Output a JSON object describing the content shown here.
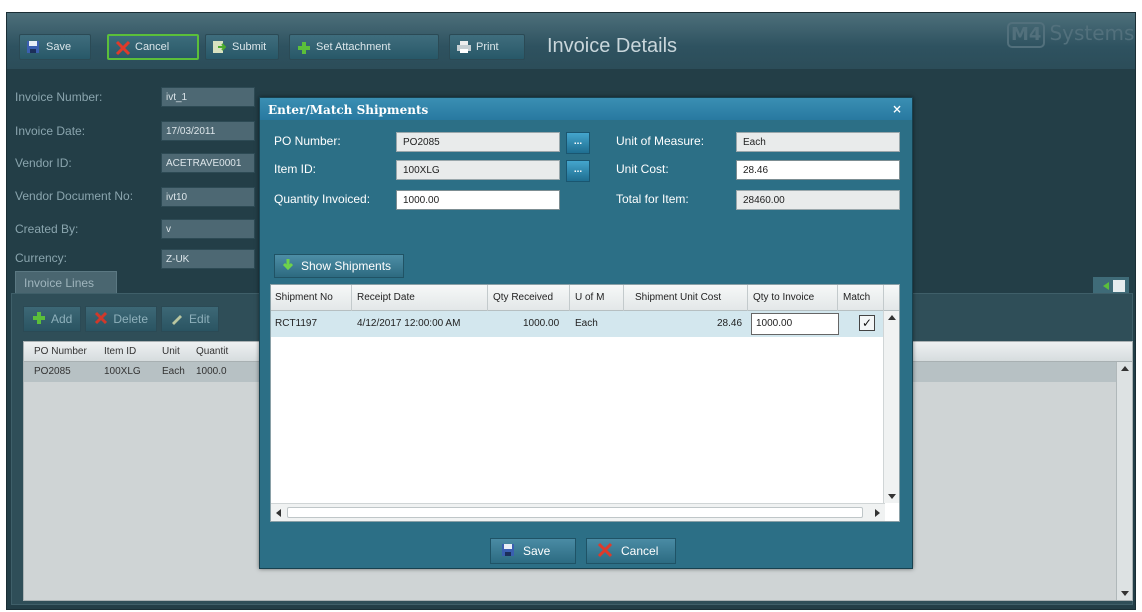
{
  "toolbar": {
    "save": "Save",
    "cancel": "Cancel",
    "submit": "Submit",
    "set_attachment": "Set Attachment",
    "print": "Print",
    "title": "Invoice Details",
    "brand_logo": "M4",
    "brand_name": "Systems"
  },
  "form": {
    "invoice_number_label": "Invoice Number:",
    "invoice_number": "ivt_1",
    "invoice_date_label": "Invoice Date:",
    "invoice_date": "17/03/2011",
    "vendor_id_label": "Vendor ID:",
    "vendor_id": "ACETRAVE0001",
    "vendor_doc_label": "Vendor Document No:",
    "vendor_doc": "ivt10",
    "created_by_label": "Created By:",
    "created_by": "v",
    "currency_label": "Currency:",
    "currency": "Z-UK"
  },
  "lines": {
    "tab_label": "Invoice Lines",
    "add": "Add",
    "delete": "Delete",
    "edit": "Edit",
    "columns": [
      "PO Number",
      "Item ID",
      "Unit",
      "Quantit"
    ],
    "row": [
      "PO2085",
      "100XLG",
      "Each",
      "1000.0"
    ]
  },
  "modal": {
    "title": "Enter/Match Shipments",
    "close": "×",
    "po_number_label": "PO Number:",
    "po_number": "PO2085",
    "item_id_label": "Item ID:",
    "item_id": "100XLG",
    "qty_invoiced_label": "Quantity Invoiced:",
    "qty_invoiced": "1000.00",
    "uom_label": "Unit of Measure:",
    "uom": "Each",
    "unit_cost_label": "Unit Cost:",
    "unit_cost": "28.46",
    "total_label": "Total for Item:",
    "total": "28460.00",
    "ellipsis": "...",
    "show_shipments": "Show Shipments",
    "columns": [
      "Shipment No",
      "Receipt Date",
      "Qty Received",
      "U of M",
      "Shipment Unit Cost",
      "Qty to Invoice",
      "Match"
    ],
    "row": {
      "shipment_no": "RCT1197",
      "receipt_date": "4/12/2017 12:00:00 AM",
      "qty_received": "1000.00",
      "uom": "Each",
      "unit_cost": "28.46",
      "qty_to_invoice": "1000.00",
      "match": "✓"
    },
    "save": "Save",
    "cancel": "Cancel"
  },
  "colors": {
    "background": "#233e47",
    "modal": "#2c6f86",
    "accent_green": "#5bbf3a",
    "cancel_red": "#e03a2a"
  }
}
